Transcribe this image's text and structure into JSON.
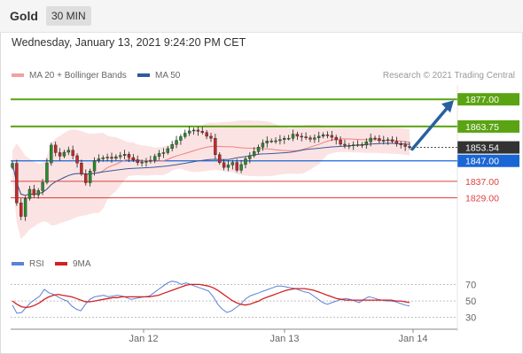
{
  "header": {
    "instrument": "Gold",
    "timeframe": "30 MIN"
  },
  "datetime": "Wednesday, January 13, 2021 9:24:20 PM CET",
  "legend": {
    "ma20_bb": "MA 20 + Bollinger Bands",
    "ma50": "MA 50",
    "rsi": "RSI",
    "ma9": "9MA"
  },
  "copyright": "Research © 2021 Trading Central",
  "colors": {
    "green": "#5aa312",
    "blue": "#1a66d4",
    "red": "#e04040",
    "bb_fill": "#fadada",
    "ma20": "#f08080",
    "ma50": "#3a5a9a",
    "arrow": "#2a5f9f",
    "rsi": "#5a82d8",
    "ma9": "#d42020",
    "candle_up": "#2c8a2c",
    "candle_down": "#c62828"
  },
  "chart_data": [
    {
      "type": "candlestick",
      "x_ticks": [
        "Jan 12",
        "Jan 13",
        "Jan 14"
      ],
      "ylim": [
        1802,
        1884
      ],
      "last_price": 1853.54,
      "levels": [
        {
          "value": 1877.0,
          "label": "1877.00",
          "kind": "resistance"
        },
        {
          "value": 1863.75,
          "label": "1863.75",
          "kind": "resistance"
        },
        {
          "value": 1847.0,
          "label": "1847.00",
          "kind": "pivot"
        },
        {
          "value": 1837.0,
          "label": "1837.00",
          "kind": "support"
        },
        {
          "value": 1829.0,
          "label": "1829.00",
          "kind": "support"
        }
      ],
      "last_label": "1853.54",
      "close": [
        1845.8,
        1826.5,
        1819.9,
        1828.6,
        1833.1,
        1830.4,
        1832.5,
        1836.5,
        1846.0,
        1854.7,
        1851.0,
        1849.3,
        1851.2,
        1852.2,
        1849.5,
        1845.9,
        1840.6,
        1836.3,
        1842.0,
        1847.0,
        1848.0,
        1848.5,
        1848.8,
        1848.2,
        1849.0,
        1849.6,
        1850.2,
        1848.6,
        1847.4,
        1846.1,
        1846.4,
        1846.7,
        1847.3,
        1849.2,
        1850.6,
        1851.0,
        1853.0,
        1855.0,
        1857.0,
        1858.8,
        1860.5,
        1861.6,
        1862.0,
        1861.4,
        1860.8,
        1859.0,
        1858.0,
        1850.0,
        1846.1,
        1843.8,
        1845.0,
        1846.2,
        1842.4,
        1845.2,
        1848.0,
        1849.5,
        1851.5,
        1853.7,
        1855.7,
        1856.7,
        1856.7,
        1856.8,
        1857.4,
        1858.0,
        1858.0,
        1860.0,
        1859.0,
        1858.7,
        1858.2,
        1857.5,
        1858.2,
        1859.0,
        1859.7,
        1859.4,
        1858.5,
        1857.2,
        1855.1,
        1854.5,
        1854.5,
        1854.8,
        1854.9,
        1854.7,
        1856.3,
        1858.1,
        1857.9,
        1856.8,
        1857.0,
        1857.3,
        1856.5,
        1855.3,
        1854.8,
        1854.0,
        1853.5
      ],
      "open": [
        1843.8,
        1845.8,
        1826.5,
        1819.9,
        1828.6,
        1833.1,
        1830.4,
        1832.5,
        1836.5,
        1846.0,
        1854.7,
        1851.0,
        1849.3,
        1851.2,
        1852.2,
        1849.5,
        1845.9,
        1840.6,
        1836.3,
        1842.0,
        1847.0,
        1848.0,
        1848.5,
        1848.8,
        1848.2,
        1849.0,
        1849.6,
        1850.2,
        1848.6,
        1847.4,
        1846.1,
        1846.4,
        1846.7,
        1847.3,
        1849.2,
        1850.6,
        1851.0,
        1853.0,
        1855.0,
        1857.0,
        1858.8,
        1860.5,
        1861.6,
        1862.0,
        1861.4,
        1860.8,
        1859.0,
        1858.0,
        1850.0,
        1846.1,
        1843.8,
        1845.0,
        1846.2,
        1842.4,
        1845.2,
        1848.0,
        1849.5,
        1851.5,
        1853.7,
        1855.7,
        1856.7,
        1856.7,
        1856.8,
        1857.4,
        1858.0,
        1858.0,
        1860.0,
        1859.0,
        1858.7,
        1858.2,
        1857.5,
        1858.2,
        1859.0,
        1859.7,
        1859.4,
        1858.5,
        1857.2,
        1855.1,
        1854.5,
        1854.5,
        1854.8,
        1854.9,
        1854.7,
        1856.3,
        1858.1,
        1857.9,
        1856.8,
        1857.0,
        1857.3,
        1856.5,
        1855.3,
        1854.8,
        1854.0
      ],
      "annotation": "arrow up toward 1877.00"
    },
    {
      "type": "line",
      "name": "RSI",
      "ylim": [
        20,
        78
      ],
      "y_ticks": [
        70,
        50,
        30
      ],
      "series": [
        {
          "name": "RSI",
          "values": [
            45,
            35,
            36,
            42,
            48,
            52,
            56,
            64,
            60,
            58,
            55,
            52,
            50,
            44,
            40,
            38,
            46,
            52,
            55,
            56,
            57,
            55,
            56,
            57,
            56,
            54,
            52,
            53,
            54,
            55,
            56,
            60,
            64,
            68,
            72,
            74,
            73,
            70,
            72,
            70,
            68,
            66,
            64,
            62,
            55,
            46,
            40,
            36,
            38,
            42,
            46,
            52,
            56,
            58,
            60,
            62,
            64,
            66,
            68,
            68,
            67,
            66,
            65,
            63,
            61,
            60,
            56,
            52,
            48,
            46,
            48,
            50,
            52,
            53,
            52,
            50,
            48,
            52,
            55,
            54,
            52,
            51,
            50,
            50,
            49,
            47,
            45,
            44
          ]
        },
        {
          "name": "9MA",
          "values": [
            50,
            46,
            43,
            42,
            43,
            45,
            48,
            52,
            55,
            57,
            58,
            57,
            56,
            55,
            53,
            51,
            49,
            49,
            50,
            51,
            52,
            53,
            54,
            54,
            55,
            55,
            55,
            55,
            55,
            55,
            55,
            56,
            57,
            59,
            61,
            63,
            65,
            67,
            69,
            70,
            70,
            70,
            69,
            68,
            66,
            63,
            59,
            55,
            51,
            48,
            46,
            45,
            46,
            48,
            50,
            53,
            55,
            57,
            59,
            61,
            63,
            64,
            65,
            65,
            65,
            64,
            63,
            61,
            59,
            57,
            55,
            53,
            52,
            51,
            51,
            51,
            51,
            51,
            51,
            51,
            51,
            51,
            51,
            51,
            50,
            50,
            49,
            48
          ]
        }
      ]
    }
  ]
}
